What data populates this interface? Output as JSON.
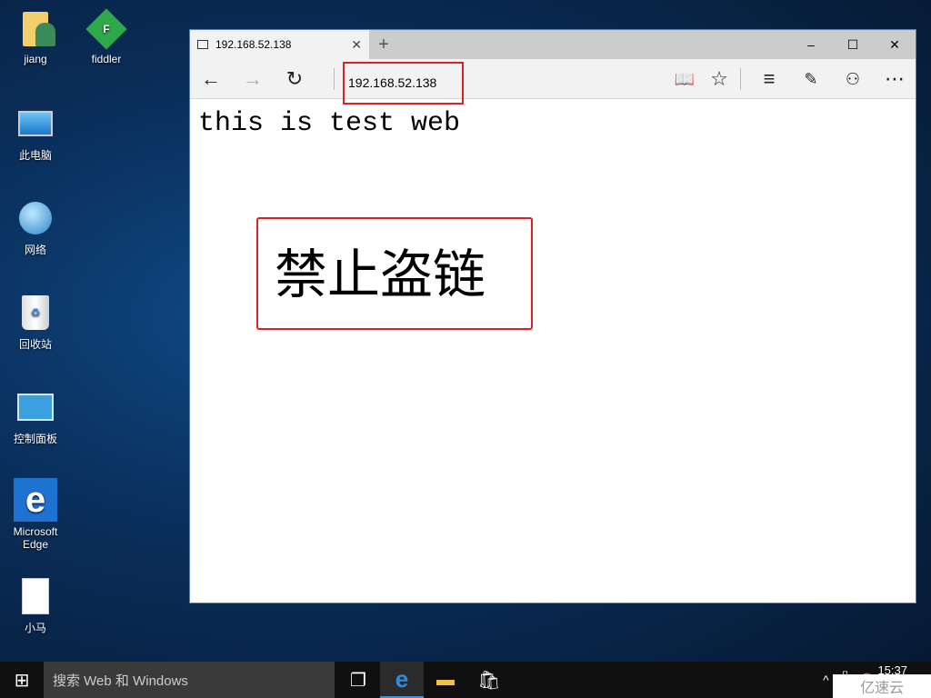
{
  "desktop": {
    "icons": [
      {
        "label": "jiang"
      },
      {
        "label": "fiddler"
      },
      {
        "label": "此电脑"
      },
      {
        "label": "网络"
      },
      {
        "label": "回收站"
      },
      {
        "label": "控制面板"
      },
      {
        "label": "Microsoft Edge"
      },
      {
        "label": "小马"
      }
    ]
  },
  "browser": {
    "tab_title": "192.168.52.138",
    "address": "192.168.52.138",
    "page_heading": "this is test web",
    "page_notice": "禁止盗链"
  },
  "taskbar": {
    "search_placeholder": "搜索 Web 和 Windows",
    "time": "15:37"
  },
  "watermark": "亿速云"
}
